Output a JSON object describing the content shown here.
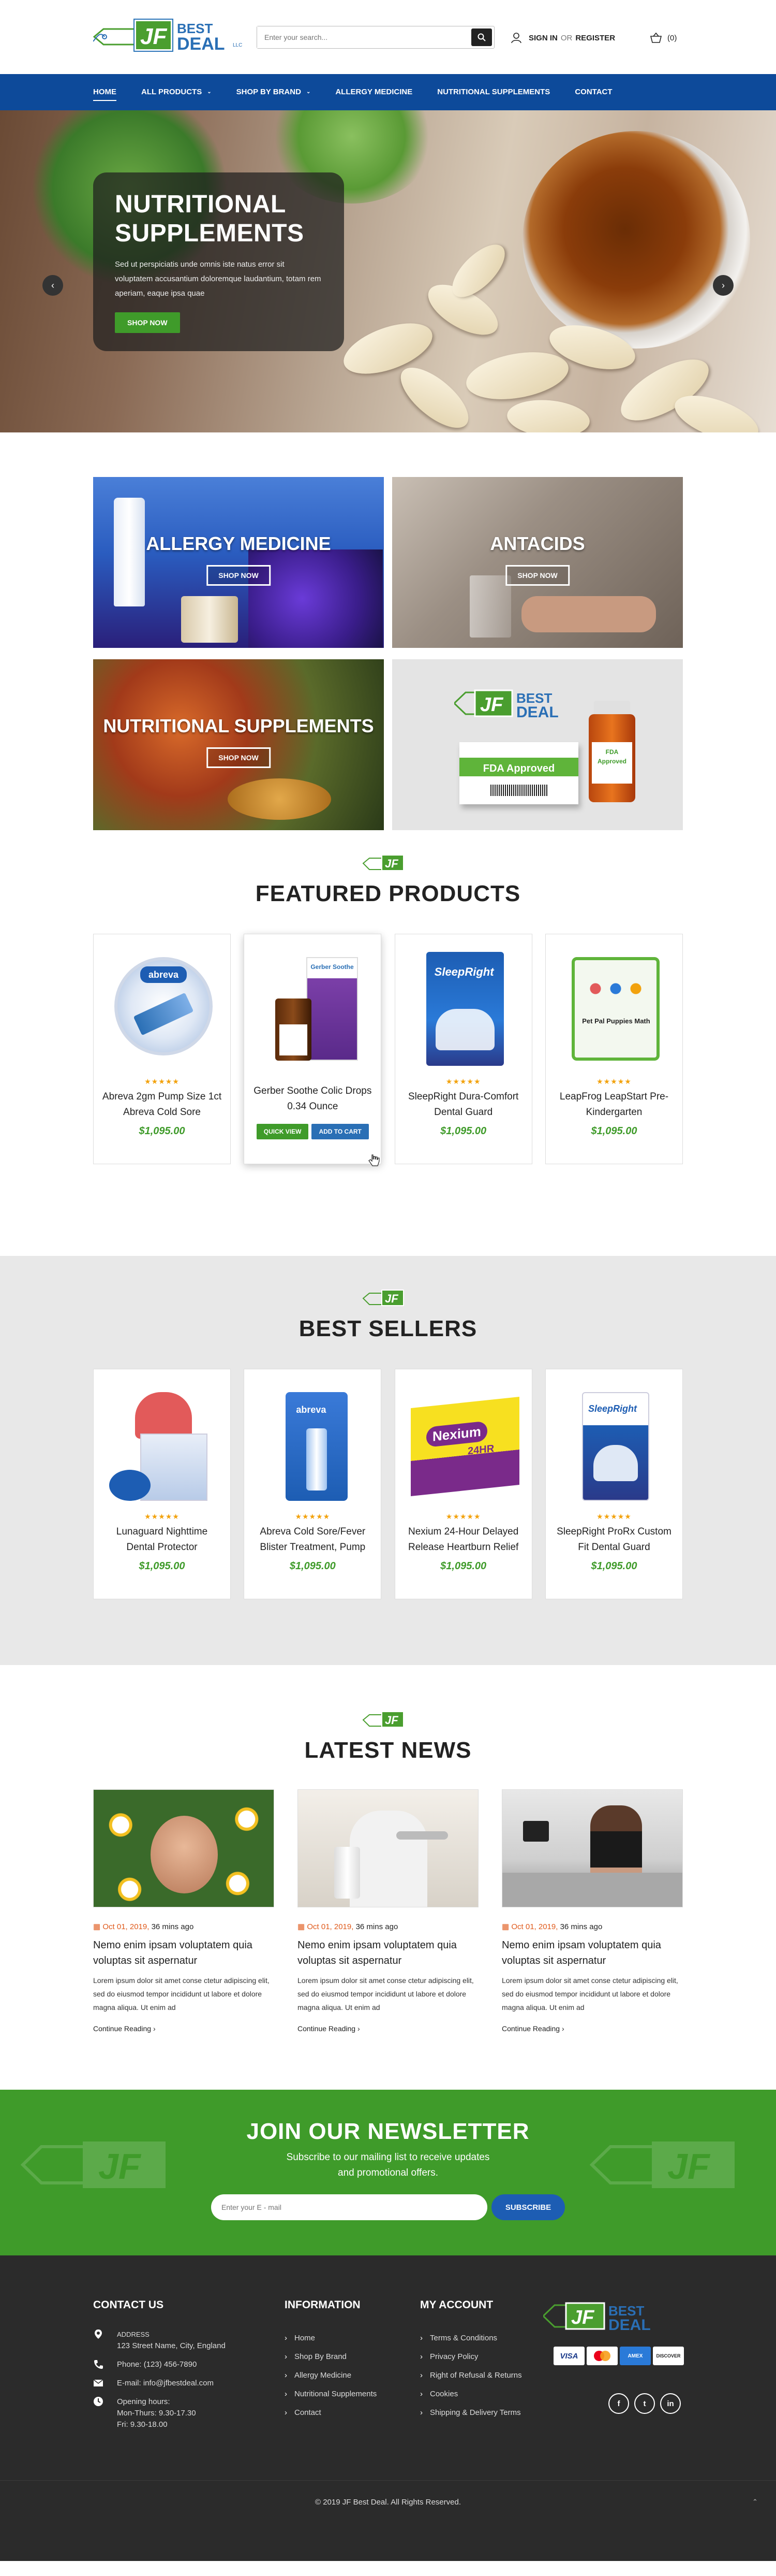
{
  "header": {
    "logo": {
      "mark": "JF",
      "word1": "BEST",
      "word2": "DEAL",
      "suffix": "LLC"
    },
    "search": {
      "placeholder": "Enter your search..."
    },
    "account": {
      "sign_in": "SIGN IN",
      "or": "OR",
      "register": "REGISTER"
    },
    "cart": {
      "count_label": "(0)"
    }
  },
  "nav": {
    "items": [
      {
        "label": "HOME",
        "active": true
      },
      {
        "label": "ALL PRODUCTS",
        "dropdown": true
      },
      {
        "label": "SHOP BY BRAND",
        "dropdown": true
      },
      {
        "label": "ALLERGY MEDICINE"
      },
      {
        "label": "NUTRITIONAL SUPPLEMENTS"
      },
      {
        "label": "CONTACT"
      }
    ]
  },
  "hero": {
    "title_line1": "NUTRITIONAL",
    "title_line2": "SUPPLEMENTS",
    "text": "Sed ut perspiciatis unde omnis iste natus error sit voluptatem accusantium doloremque laudantium, totam rem aperiam, eaque ipsa quae",
    "button": "SHOP NOW",
    "prev_arrow": "‹",
    "next_arrow": "›"
  },
  "categories": [
    {
      "title": "ALLERGY MEDICINE",
      "button": "SHOP NOW"
    },
    {
      "title": "ANTACIDS",
      "button": "SHOP NOW"
    },
    {
      "title": "NUTRITIONAL SUPPLEMENTS",
      "button": "SHOP NOW"
    },
    {
      "badge_left": "FDA Approved",
      "badge_right": "FDA Approved"
    }
  ],
  "featured": {
    "title": "FEATURED PRODUCTS",
    "items": [
      {
        "name": "Abreva 2gm Pump Size 1ct Abreva Cold Sore",
        "price": "$1,095.00",
        "brand": "abreva",
        "stars": "★★★★★"
      },
      {
        "name": "Gerber Soothe Colic Drops 0.34 Ounce",
        "price": "",
        "brand": "Gerber Soothe",
        "quick_view": "QUICK VIEW",
        "add_to_cart": "ADD TO CART"
      },
      {
        "name": "SleepRight Dura-Comfort Dental Guard",
        "price": "$1,095.00",
        "brand": "SleepRight",
        "stars": "★★★★★"
      },
      {
        "name": "LeapFrog LeapStart Pre-Kindergarten",
        "price": "$1,095.00",
        "brand": "Pet Pal Puppies Math",
        "stars": "★★★★★"
      }
    ]
  },
  "bestsellers": {
    "title": "BEST SELLERS",
    "items": [
      {
        "name": "Lunaguard Nighttime Dental Protector",
        "price": "$1,095.00",
        "stars": "★★★★★"
      },
      {
        "name": "Abreva Cold Sore/Fever Blister Treatment, Pump",
        "price": "$1,095.00",
        "brand": "abreva",
        "stars": "★★★★★"
      },
      {
        "name": "Nexium 24-Hour Delayed Release Heartburn Relief",
        "price": "$1,095.00",
        "brand": "Nexium",
        "brand_sub": "24HR",
        "stars": "★★★★★"
      },
      {
        "name": "SleepRight ProRx Custom Fit Dental Guard",
        "price": "$1,095.00",
        "brand": "SleepRight",
        "stars": "★★★★★"
      }
    ]
  },
  "news": {
    "title": "LATEST NEWS",
    "items": [
      {
        "date": "Oct 01, 2019,",
        "ago": "36 mins ago",
        "title": "Nemo enim ipsam voluptatem quia voluptas sit aspernatur",
        "excerpt": "Lorem ipsum dolor sit amet conse ctetur adipiscing elit, sed do eiusmod tempor incididunt ut labore et dolore magna aliqua. Ut enim ad",
        "more": "Continue Reading"
      },
      {
        "date": "Oct 01, 2019,",
        "ago": "36 mins ago",
        "title": "Nemo enim ipsam voluptatem quia voluptas sit aspernatur",
        "excerpt": "Lorem ipsum dolor sit amet conse ctetur adipiscing elit, sed do eiusmod tempor incididunt ut labore et dolore magna aliqua. Ut enim ad",
        "more": "Continue Reading"
      },
      {
        "date": "Oct 01, 2019,",
        "ago": "36 mins ago",
        "title": "Nemo enim ipsam voluptatem quia voluptas sit aspernatur",
        "excerpt": "Lorem ipsum dolor sit amet conse ctetur adipiscing elit, sed do eiusmod tempor incididunt ut labore et dolore magna aliqua. Ut enim ad",
        "more": "Continue Reading"
      }
    ]
  },
  "newsletter": {
    "title": "JOIN OUR NEWSLETTER",
    "line1": "Subscribe to our mailing list to receive updates",
    "line2": "and promotional offers.",
    "placeholder": "Enter your E - mail",
    "button": "SUBSCRIBE"
  },
  "footer": {
    "contact": {
      "title": "CONTACT US",
      "address_label": "ADDRESS",
      "address": "123 Street Name, City, England",
      "phone": "Phone: (123) 456-7890",
      "email": "E-mail: info@jfbestdeal.com",
      "hours_label": "Opening hours:",
      "hours1": "Mon-Thurs: 9.30-17.30",
      "hours2": "Fri: 9.30-18.00"
    },
    "information": {
      "title": "INFORMATION",
      "links": [
        "Home",
        "Shop By Brand",
        "Allergy Medicine",
        "Nutritional Supplements",
        "Contact"
      ]
    },
    "account": {
      "title": "MY ACCOUNT",
      "links": [
        "Terms & Conditions",
        "Privacy Policy",
        "Right of Refusal & Returns",
        "Cookies",
        "Shipping & Delivery Terms"
      ]
    },
    "payments": [
      "VISA",
      "MC",
      "AMEX",
      "DISCOVER"
    ],
    "social": [
      "f",
      "t",
      "in"
    ],
    "copyright": "© 2019 JF Best Deal. All Rights Reserved."
  },
  "colors": {
    "brand_blue": "#0d4a9a",
    "brand_green": "#3f9b2a",
    "price_green": "#3f9b2a",
    "footer": "#2b2b2b"
  }
}
